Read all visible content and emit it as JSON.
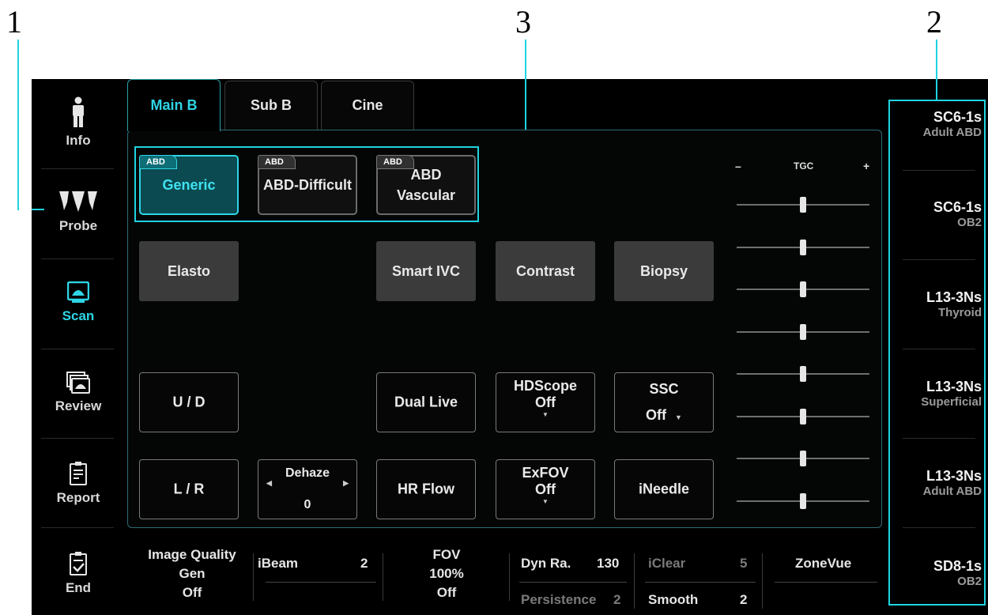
{
  "callouts": [
    "1",
    "3",
    "2"
  ],
  "sidebar": {
    "items": [
      {
        "label": "Info",
        "icon": "person-icon"
      },
      {
        "label": "Probe",
        "icon": "probe-icon"
      },
      {
        "label": "Scan",
        "icon": "scan-icon",
        "active": true
      },
      {
        "label": "Review",
        "icon": "review-icon"
      },
      {
        "label": "Report",
        "icon": "report-icon"
      },
      {
        "label": "End",
        "icon": "end-icon"
      }
    ]
  },
  "tabs": [
    {
      "label": "Main B",
      "active": true
    },
    {
      "label": "Sub B"
    },
    {
      "label": "Cine"
    }
  ],
  "presets": [
    {
      "tag": "ABD",
      "label": "Generic",
      "active": true
    },
    {
      "tag": "ABD",
      "label": "ABD-Difficult"
    },
    {
      "tag": "ABD",
      "label_line1": "ABD",
      "label_line2": "Vascular"
    }
  ],
  "functions": {
    "elasto": "Elasto",
    "smart_ivc": "Smart IVC",
    "contrast": "Contrast",
    "biopsy": "Biopsy"
  },
  "controls": {
    "ud": "U / D",
    "dual_live": "Dual Live",
    "hdscope_label": "HDScope",
    "hdscope_value": "Off",
    "ssc_label": "SSC",
    "ssc_value": "Off",
    "lr": "L / R",
    "dehaze_label": "Dehaze",
    "dehaze_value": "0",
    "hr_flow": "HR Flow",
    "exfov_label": "ExFOV",
    "exfov_value": "Off",
    "ineedle": "iNeedle"
  },
  "tgc": {
    "label": "TGC",
    "minus": "–",
    "plus": "+",
    "levels": [
      0.5,
      0.5,
      0.5,
      0.5,
      0.5,
      0.5,
      0.5,
      0.5
    ]
  },
  "probes": [
    {
      "name": "SC6-1s",
      "preset": "Adult ABD"
    },
    {
      "name": "SC6-1s",
      "preset": "OB2"
    },
    {
      "name": "L13-3Ns",
      "preset": "Thyroid"
    },
    {
      "name": "L13-3Ns",
      "preset": "Superficial"
    },
    {
      "name": "L13-3Ns",
      "preset": "Adult ABD"
    },
    {
      "name": "SD8-1s",
      "preset": "OB2"
    }
  ],
  "bottom": {
    "image_quality": "Image Quality",
    "iq_gen": "Gen",
    "iq_off": "Off",
    "ibeam": "iBeam",
    "ibeam_val": "2",
    "fov": "FOV",
    "fov_pct": "100%",
    "fov_off": "Off",
    "dyn_ra": "Dyn Ra.",
    "dyn_ra_val": "130",
    "persistence": "Persistence",
    "persistence_val": "2",
    "iclear": "iClear",
    "iclear_val": "5",
    "smooth": "Smooth",
    "smooth_val": "2",
    "zonevue": "ZoneVue"
  },
  "colors": {
    "accent": "#2ed5e6",
    "callout_line": "#1fd3e0"
  }
}
